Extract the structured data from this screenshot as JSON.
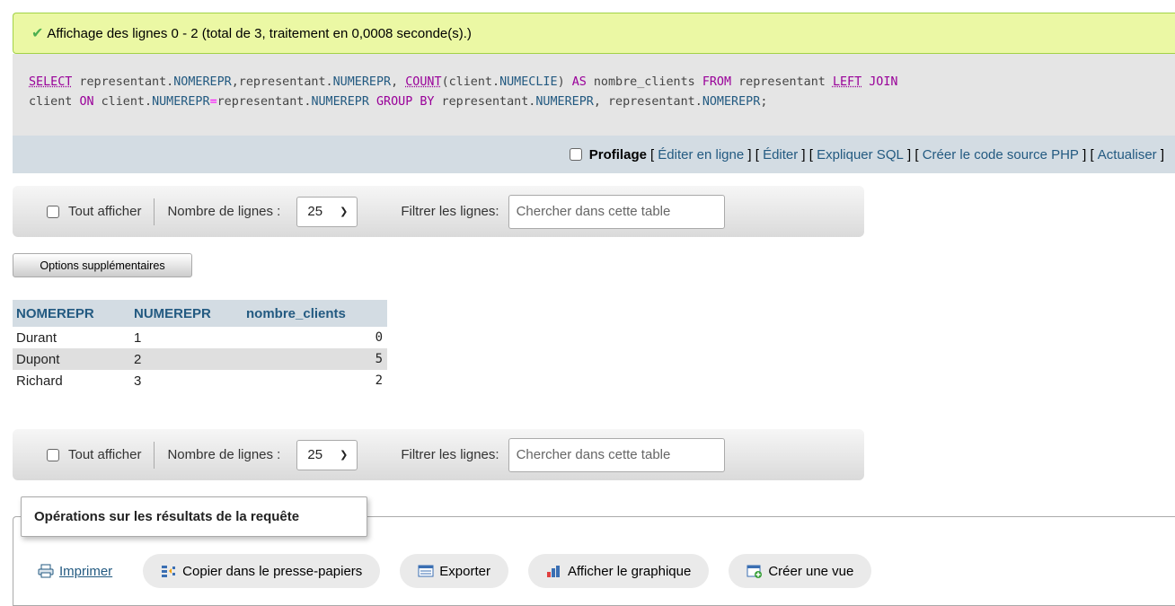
{
  "success": {
    "message": "Affichage des lignes 0 - 2 (total de 3, traitement en 0,0008 seconde(s).)"
  },
  "sql": {
    "line1": [
      {
        "t": "SELECT",
        "c": "fn"
      },
      {
        "t": " representant.",
        "c": ""
      },
      {
        "t": "NOMEREPR",
        "c": "col"
      },
      {
        "t": ",representant.",
        "c": ""
      },
      {
        "t": "NUMEREPR",
        "c": "col"
      },
      {
        "t": ", ",
        "c": ""
      },
      {
        "t": "COUNT",
        "c": "fn"
      },
      {
        "t": "(client.",
        "c": ""
      },
      {
        "t": "NUMECLIE",
        "c": "col"
      },
      {
        "t": ") ",
        "c": ""
      },
      {
        "t": "AS",
        "c": "kw"
      },
      {
        "t": " nombre_clients ",
        "c": ""
      },
      {
        "t": "FROM",
        "c": "kw"
      },
      {
        "t": " representant ",
        "c": ""
      },
      {
        "t": "LEFT",
        "c": "fn"
      },
      {
        "t": " ",
        "c": ""
      },
      {
        "t": "JOIN",
        "c": "kw"
      }
    ],
    "line2": [
      {
        "t": "client ",
        "c": ""
      },
      {
        "t": "ON",
        "c": "kw"
      },
      {
        "t": " client.",
        "c": ""
      },
      {
        "t": "NUMEREPR",
        "c": "col"
      },
      {
        "t": "=",
        "c": "op"
      },
      {
        "t": "representant.",
        "c": ""
      },
      {
        "t": "NUMEREPR",
        "c": "col"
      },
      {
        "t": " ",
        "c": ""
      },
      {
        "t": "GROUP BY",
        "c": "kw"
      },
      {
        "t": " representant.",
        "c": ""
      },
      {
        "t": "NUMEREPR",
        "c": "col"
      },
      {
        "t": ", representant.",
        "c": ""
      },
      {
        "t": "NOMEREPR",
        "c": "col"
      },
      {
        "t": ";",
        "c": ""
      }
    ]
  },
  "profile_bar": {
    "profilage": "Profilage",
    "links": [
      "Éditer en ligne",
      "Éditer",
      "Expliquer SQL",
      "Créer le code source PHP",
      "Actualiser"
    ]
  },
  "nav": {
    "show_all": "Tout afficher",
    "rows_label": "Nombre de lignes :",
    "rows_value": "25",
    "filter_label": "Filtrer les lignes:",
    "filter_placeholder": "Chercher dans cette table"
  },
  "options_button": "Options supplémentaires",
  "table": {
    "columns": [
      "NOMEREPR",
      "NUMEREPR",
      "nombre_clients"
    ],
    "rows": [
      [
        "Durant",
        "1",
        "0"
      ],
      [
        "Dupont",
        "2",
        "5"
      ],
      [
        "Richard",
        "3",
        "2"
      ]
    ]
  },
  "operations": {
    "legend": "Opérations sur les résultats de la requête",
    "print": "Imprimer",
    "copy": "Copier dans le presse-papiers",
    "export": "Exporter",
    "chart": "Afficher le graphique",
    "view": "Créer une vue"
  },
  "colors": {
    "success_bg": "#ebf8a4",
    "link": "#235a81",
    "header_bg": "#d3dce3"
  }
}
